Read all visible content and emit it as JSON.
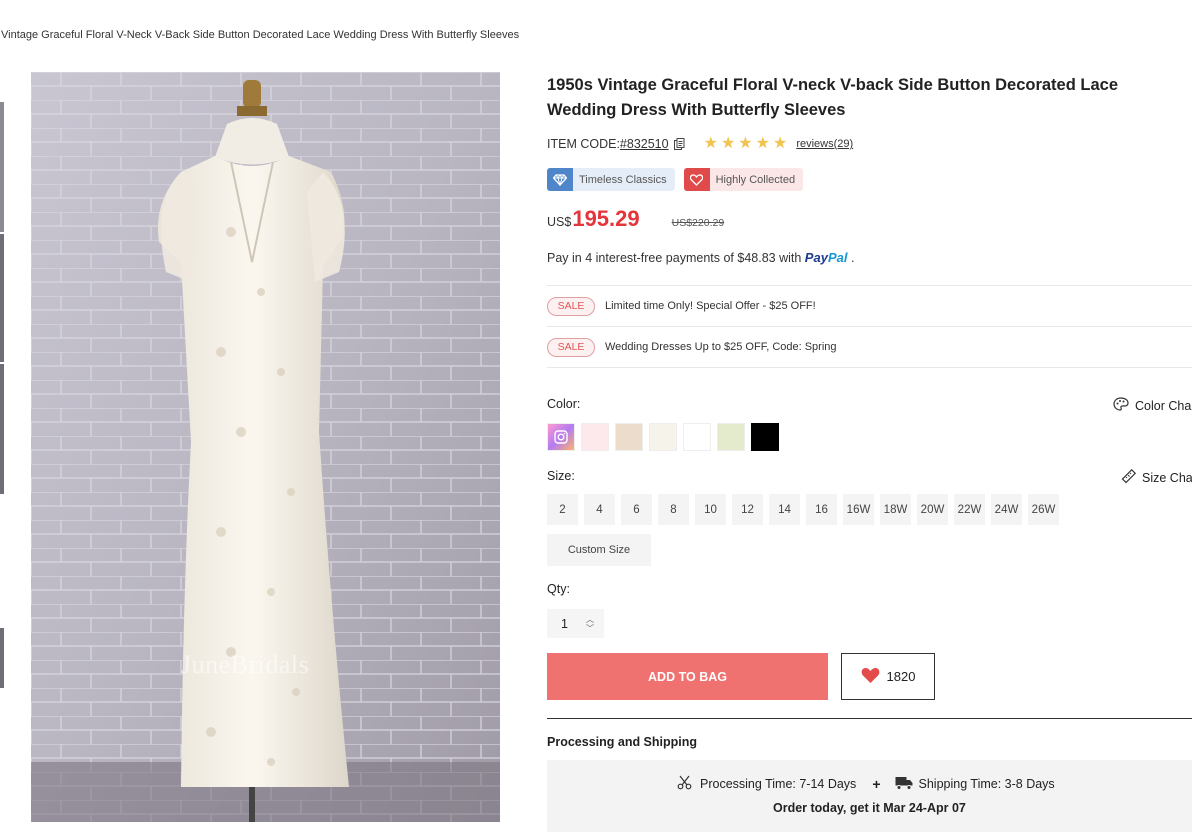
{
  "breadcrumb": "Vintage Graceful Floral V-Neck V-Back Side Button Decorated Lace Wedding Dress With Butterfly Sleeves",
  "product": {
    "title": "1950s Vintage Graceful Floral V-neck V-back Side Button Decorated Lace Wedding Dress With Butterfly Sleeves",
    "item_code_label": "ITEM CODE:",
    "item_code": "#832510",
    "rating": 5,
    "reviews": "reviews(29)",
    "image_watermark": "JuneBridals"
  },
  "badges": [
    {
      "label": "Timeless Classics",
      "icon": "diamond-icon"
    },
    {
      "label": "Highly Collected",
      "icon": "heart-icon"
    }
  ],
  "price": {
    "currency": "US$",
    "current": "195.29",
    "original": "US$220.29",
    "color": "#e4353b"
  },
  "paypal": {
    "text": "Pay in 4 interest-free payments of $48.83 with",
    "brand_part1": "Pay",
    "brand_part2": "Pal",
    "suffix": "."
  },
  "promotions": [
    {
      "tag": "SALE",
      "text": "Limited time Only! Special Offer - $25 OFF!"
    },
    {
      "tag": "SALE",
      "text": "Wedding Dresses Up to $25 OFF, Code: Spring"
    }
  ],
  "color": {
    "label": "Color:",
    "chart_link": "Color Cha",
    "swatches": [
      "photo",
      "#fde8ec",
      "#ecdccb",
      "#f6f4ea",
      "#ffffff",
      "#e4ebcc",
      "#000000"
    ]
  },
  "size": {
    "label": "Size:",
    "chart_link": "Size Cha",
    "options": [
      "2",
      "4",
      "6",
      "8",
      "10",
      "12",
      "14",
      "16",
      "16W",
      "18W",
      "20W",
      "22W",
      "24W",
      "26W"
    ],
    "custom": "Custom Size"
  },
  "qty": {
    "label": "Qty:",
    "value": "1"
  },
  "actions": {
    "add_to_bag": "ADD TO BAG",
    "wishlist_count": "1820",
    "accent": "#ef7270"
  },
  "shipping": {
    "title": "Processing and Shipping",
    "processing": "Processing Time: 7-14 Days",
    "plus": "+",
    "shipping_time": "Shipping Time: 3-8 Days",
    "order_today": "Order today, get it Mar 24-Apr 07"
  }
}
